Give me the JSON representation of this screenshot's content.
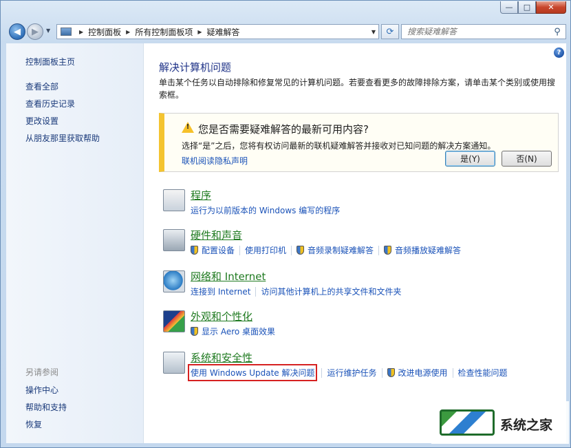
{
  "window": {
    "caption_buttons": {
      "minimize": "—",
      "maximize": "□",
      "close": "✕"
    }
  },
  "nav": {
    "breadcrumb": [
      "控制面板",
      "所有控制面板项",
      "疑难解答"
    ],
    "search_placeholder": "搜索疑难解答"
  },
  "sidebar": {
    "top_links": [
      "控制面板主页",
      "查看全部",
      "查看历史记录",
      "更改设置",
      "从朋友那里获取帮助"
    ],
    "see_also_heading": "另请参阅",
    "see_also_links": [
      "操作中心",
      "帮助和支持",
      "恢复"
    ]
  },
  "main": {
    "title": "解决计算机问题",
    "description": "单击某个任务以自动排除和修复常见的计算机问题。若要查看更多的故障排除方案，请单击某个类别或使用搜索框。",
    "infobar": {
      "title": "您是否需要疑难解答的最新可用内容?",
      "text": "选择“是”之后，您将有权访问最新的联机疑难解答并接收对已知问题的解决方案通知。",
      "link": "联机阅读隐私声明",
      "yes_label": "是(Y)",
      "no_label": "否(N)"
    },
    "categories": [
      {
        "title": "程序",
        "icon": "programs-icon",
        "links": [
          {
            "text": "运行为以前版本的 Windows 编写的程序",
            "shield": false
          }
        ]
      },
      {
        "title": "硬件和声音",
        "icon": "hardware-sound-icon",
        "links": [
          {
            "text": "配置设备",
            "shield": true
          },
          {
            "text": "使用打印机",
            "shield": false
          },
          {
            "text": "音频录制疑难解答",
            "shield": true
          },
          {
            "text": "音频播放疑难解答",
            "shield": true
          }
        ]
      },
      {
        "title": "网络和 Internet",
        "icon": "network-internet-icon",
        "links": [
          {
            "text": "连接到 Internet",
            "shield": false
          },
          {
            "text": "访问其他计算机上的共享文件和文件夹",
            "shield": false
          }
        ]
      },
      {
        "title": "外观和个性化",
        "icon": "appearance-icon",
        "links": [
          {
            "text": "显示 Aero 桌面效果",
            "shield": true
          }
        ]
      },
      {
        "title": "系统和安全性",
        "icon": "system-security-icon",
        "links": [
          {
            "text": "使用 Windows Update 解决问题",
            "shield": false,
            "highlighted": true
          },
          {
            "text": "运行维护任务",
            "shield": false
          },
          {
            "text": "改进电源使用",
            "shield": true
          },
          {
            "text": "检查性能问题",
            "shield": false
          }
        ]
      }
    ]
  },
  "watermark": {
    "text": "系统之家"
  }
}
